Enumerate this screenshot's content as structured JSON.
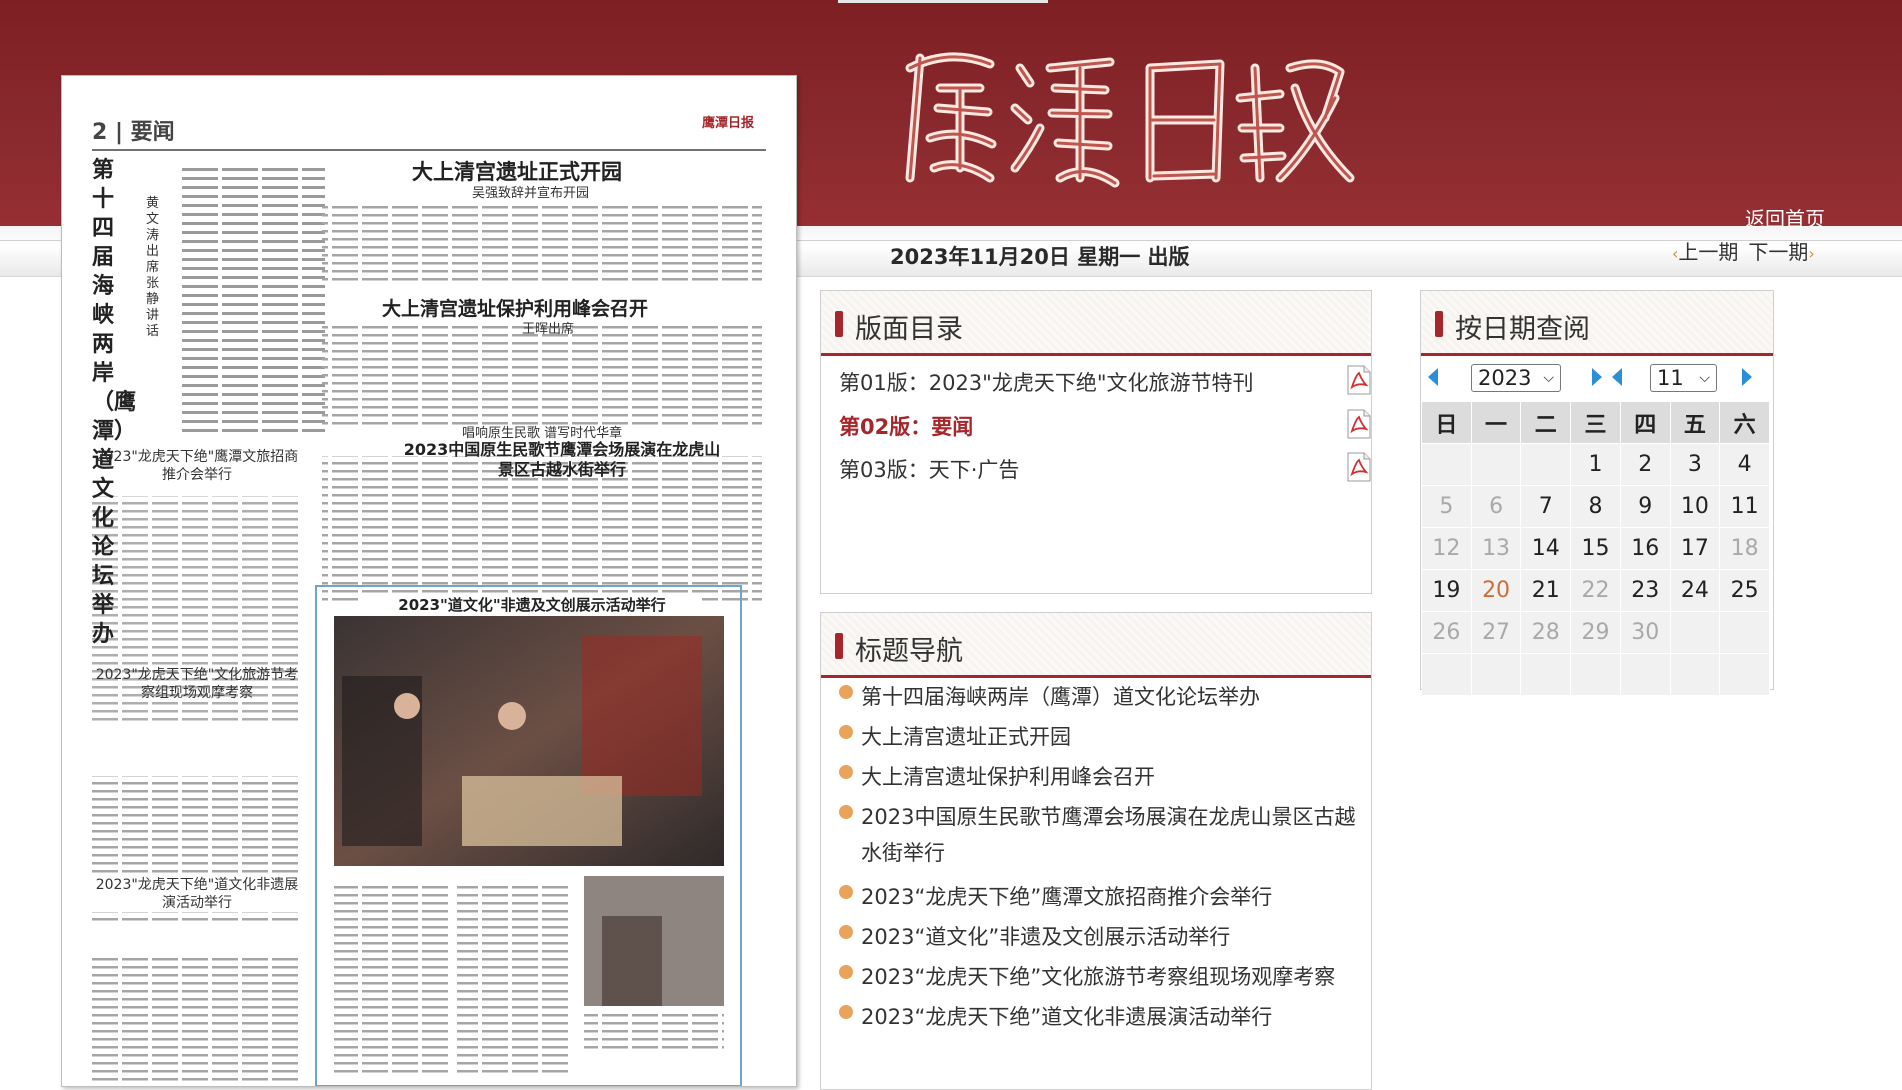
{
  "header": {
    "masthead": "鹰潭日报",
    "home_link": "返回首页",
    "issue_date": "2023年11月20日 星期一 出版",
    "prev_issue": "上一期",
    "next_issue": "下一期"
  },
  "newspaper_page": {
    "page_label": "2",
    "section": "要闻",
    "top_headline": "大上清宫遗址正式开园",
    "top_sub": "吴强致辞并宣布开园",
    "left_vertical_headline": "第十四届海峡两岸（鹰潭）道文化论坛举办",
    "left_vertical_sub": "黄文涛出席 张静讲话",
    "headline_2": "大上清宫遗址保护利用峰会召开",
    "headline_2_sub": "王晖出席",
    "headline_3_kicker": "唱响原生民歌 谱写时代华章",
    "headline_3": "2023中国原生民歌节鹰潭会场展演在龙虎山景区古越水街举行",
    "left_headline_a": "2023\"龙虎天下绝\"鹰潭文旅招商推介会举行",
    "left_headline_b": "2023\"龙虎天下绝\"文化旅游节考察组现场观摩考察",
    "left_headline_c": "2023\"龙虎天下绝\"道文化非遗展演活动举行",
    "box_headline": "2023\"道文化\"非遗及文创展示活动举行"
  },
  "page_directory": {
    "title": "版面目录",
    "items": [
      {
        "label": "第01版：2023\"龙虎天下绝\"文化旅游节特刊",
        "active": false
      },
      {
        "label": "第02版：要闻",
        "active": true
      },
      {
        "label": "第03版：天下·广告",
        "active": false
      }
    ]
  },
  "title_nav": {
    "title": "标题导航",
    "items": [
      "第十四届海峡两岸（鹰潭）道文化论坛举办",
      "大上清宫遗址正式开园",
      "大上清宫遗址保护利用峰会召开",
      "2023中国原生民歌节鹰潭会场展演在龙虎山景区古越水街举行",
      "2023“龙虎天下绝”鹰潭文旅招商推介会举行",
      "2023“道文化”非遗及文创展示活动举行",
      "2023“龙虎天下绝”文化旅游节考察组现场观摩考察",
      "2023“龙虎天下绝”道文化非遗展演活动举行"
    ]
  },
  "calendar": {
    "title": "按日期查阅",
    "year": "2023",
    "month": "11",
    "weekdays": [
      "日",
      "一",
      "二",
      "三",
      "四",
      "五",
      "六"
    ],
    "cells": [
      {
        "t": "",
        "s": "e"
      },
      {
        "t": "",
        "s": "e"
      },
      {
        "t": "",
        "s": "e"
      },
      {
        "t": "1",
        "s": "d"
      },
      {
        "t": "2",
        "s": "d"
      },
      {
        "t": "3",
        "s": "d"
      },
      {
        "t": "4",
        "s": "d"
      },
      {
        "t": "5",
        "s": "g"
      },
      {
        "t": "6",
        "s": "g"
      },
      {
        "t": "7",
        "s": "d"
      },
      {
        "t": "8",
        "s": "d"
      },
      {
        "t": "9",
        "s": "d"
      },
      {
        "t": "10",
        "s": "d"
      },
      {
        "t": "11",
        "s": "d"
      },
      {
        "t": "12",
        "s": "g"
      },
      {
        "t": "13",
        "s": "g"
      },
      {
        "t": "14",
        "s": "d"
      },
      {
        "t": "15",
        "s": "d"
      },
      {
        "t": "16",
        "s": "d"
      },
      {
        "t": "17",
        "s": "d"
      },
      {
        "t": "18",
        "s": "g"
      },
      {
        "t": "19",
        "s": "d"
      },
      {
        "t": "20",
        "s": "hl"
      },
      {
        "t": "21",
        "s": "d"
      },
      {
        "t": "22",
        "s": "g"
      },
      {
        "t": "23",
        "s": "d"
      },
      {
        "t": "24",
        "s": "d"
      },
      {
        "t": "25",
        "s": "d"
      },
      {
        "t": "26",
        "s": "g"
      },
      {
        "t": "27",
        "s": "g"
      },
      {
        "t": "28",
        "s": "g"
      },
      {
        "t": "29",
        "s": "g"
      },
      {
        "t": "30",
        "s": "g"
      },
      {
        "t": "",
        "s": "e"
      },
      {
        "t": "",
        "s": "e"
      },
      {
        "t": "",
        "s": "e"
      },
      {
        "t": "",
        "s": "e"
      },
      {
        "t": "",
        "s": "e"
      },
      {
        "t": "",
        "s": "e"
      },
      {
        "t": "",
        "s": "e"
      },
      {
        "t": "",
        "s": "e"
      },
      {
        "t": "",
        "s": "e"
      }
    ]
  },
  "colors": {
    "brand": "#8a2a2e",
    "accent": "#a5272c",
    "link_orange": "#e8a45a",
    "nav_arrow": "#2b8fd8"
  },
  "icons": [
    "pdf-icon",
    "bullet-icon",
    "prev-arrow-icon",
    "next-arrow-icon",
    "chevron-down-icon"
  ]
}
